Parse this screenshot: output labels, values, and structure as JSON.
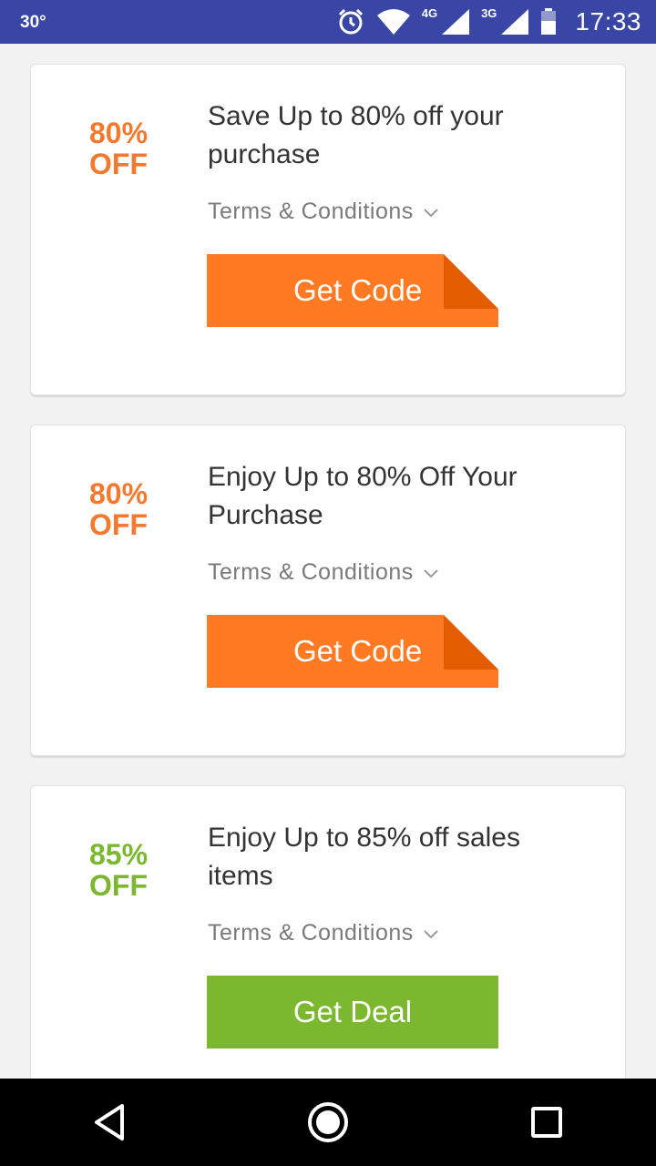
{
  "status_bar": {
    "temperature": "30°",
    "network_4g": "4G",
    "network_3g": "3G",
    "time": "17:33"
  },
  "coupons": [
    {
      "discount_value": "80%",
      "discount_suffix": "OFF",
      "title": "Save Up to 80% off your purchase",
      "terms_label": "Terms & Conditions",
      "button_label": "Get Code",
      "color": "#f4792e"
    },
    {
      "discount_value": "80%",
      "discount_suffix": "OFF",
      "title": "Enjoy Up to 80% Off Your Purchase",
      "terms_label": "Terms & Conditions",
      "button_label": "Get Code",
      "color": "#f4792e"
    },
    {
      "discount_value": "85%",
      "discount_suffix": "OFF",
      "title": "Enjoy Up to 85% off sales items",
      "terms_label": "Terms & Conditions",
      "button_label": "Get Deal",
      "color": "#7cb82f"
    }
  ],
  "navigation": {
    "icons": [
      "back-icon",
      "home-icon",
      "recents-icon"
    ]
  }
}
